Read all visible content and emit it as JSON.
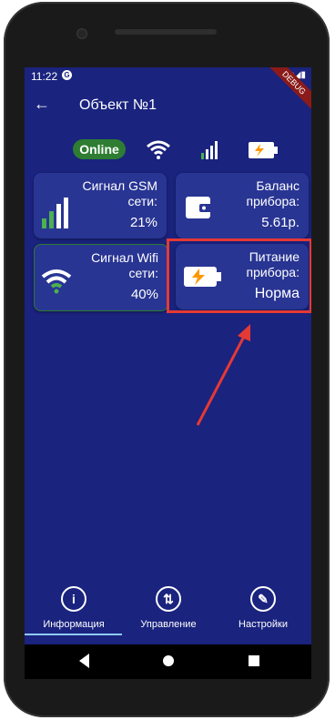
{
  "status": {
    "time": "11:22",
    "g_letter": "G",
    "icons": "▾◢▮",
    "debug": "DEBUG"
  },
  "appbar": {
    "back_icon": "←",
    "title": "Объект №1"
  },
  "indicators": {
    "online": "Online"
  },
  "cards": {
    "gsm": {
      "label": "Сигнал GSM сети:",
      "value": "21%"
    },
    "balance": {
      "label": "Баланс прибора:",
      "value": "5.61р."
    },
    "wifi": {
      "label": "Сигнал Wifi сети:",
      "value": "40%"
    },
    "power": {
      "label": "Питание прибора:",
      "value": "Норма"
    }
  },
  "nav": {
    "items": [
      {
        "label": "Информация",
        "icon": "info-icon",
        "glyph": "i"
      },
      {
        "label": "Управление",
        "icon": "swap-icon",
        "glyph": "⇅"
      },
      {
        "label": "Настройки",
        "icon": "wrench-icon",
        "glyph": "✎"
      }
    ]
  },
  "colors": {
    "screen_bg": "#1a237e",
    "card_bg": "#283593",
    "online": "#2e7d32",
    "accent_red": "#e53935",
    "battery": "#ff9800"
  }
}
